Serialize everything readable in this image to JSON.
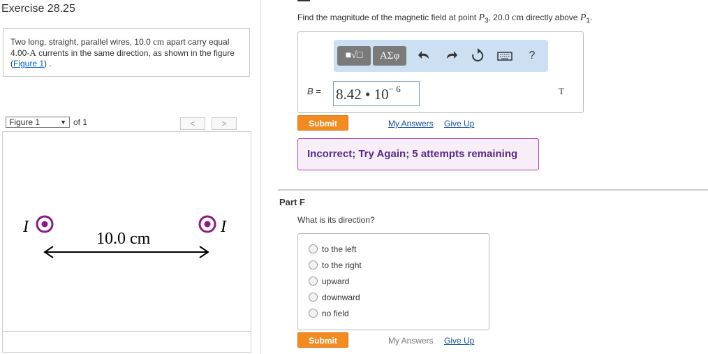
{
  "exercise": {
    "title": "Exercise 28.25"
  },
  "problem": {
    "text_1": "Two long, straight, parallel wires, 10.0 ",
    "unit_cm": "cm",
    "text_2": " apart carry equal 4.00-",
    "unit_A": "A",
    "text_3": " currents in the same direction, as shown in the figure (",
    "link": "Figure 1",
    "text_4": ") ."
  },
  "figure_nav": {
    "select_value": "Figure 1",
    "of_label": "of 1",
    "prev": "<",
    "next": ">"
  },
  "figure": {
    "current_label_left": "I",
    "current_label_right": "I",
    "distance_label": "10.0 cm"
  },
  "part_e": {
    "question_1": "Find the magnitude of the magnetic field at point ",
    "p3": "P",
    "p3_sub": "3",
    "question_2": ", 20.0 ",
    "cm": "cm",
    "question_3": " directly above ",
    "p1": "P",
    "p1_sub": "1",
    "question_4": ".",
    "toolbar": {
      "templates_label": "■√□",
      "greek_label": "ΑΣφ",
      "help_label": "?"
    },
    "variable": "B",
    "equals": " =",
    "answer_mantissa": "8.42 • 10",
    "answer_exponent": "− 6",
    "unit": "T",
    "submit": "Submit",
    "my_answers": "My Answers",
    "give_up": "Give Up",
    "feedback": "Incorrect; Try Again; 5 attempts remaining"
  },
  "part_f": {
    "heading": "Part F",
    "question": "What is its direction?",
    "options": [
      "to the left",
      "to the right",
      "upward",
      "downward",
      "no field"
    ],
    "submit": "Submit",
    "my_answers": "My Answers",
    "give_up": "Give Up"
  },
  "colors": {
    "submit": "#f28b22",
    "feedback_border": "#b040b0",
    "wire_dot": "#8a1a8a",
    "link": "#1a4f9c"
  }
}
